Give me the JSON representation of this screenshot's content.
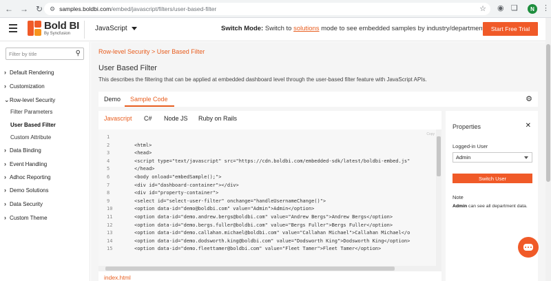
{
  "browser": {
    "url_host": "samples.boldbi.com",
    "url_path": "/embed/javascript/filters/user-based-filter",
    "profile_initial": "N"
  },
  "header": {
    "logo_text": "Bold BI",
    "logo_sub": "By Syncfusion",
    "language": "JavaScript",
    "switch_mode_label": "Switch Mode:",
    "switch_mode_pre": "Switch to",
    "switch_mode_link": "solutions",
    "switch_mode_post": "mode to see embedded samples by industry/department.",
    "trial_button": "Start Free Trial"
  },
  "sidebar": {
    "filter_placeholder": "Filter by title",
    "items": [
      {
        "label": "Default Rendering"
      },
      {
        "label": "Customization"
      },
      {
        "label": "Row-level Security"
      },
      {
        "label": "Filter Parameters"
      },
      {
        "label": "User Based Filter"
      },
      {
        "label": "Custom Attribute"
      },
      {
        "label": "Data Binding"
      },
      {
        "label": "Event Handling"
      },
      {
        "label": "Adhoc Reporting"
      },
      {
        "label": "Demo Solutions"
      },
      {
        "label": "Data Security"
      },
      {
        "label": "Custom Theme"
      }
    ]
  },
  "main": {
    "breadcrumb": "Row-level Security  >  User Based Filter",
    "title": "User Based Filter",
    "description": "This describes the filtering that can be applied at embedded dashboard level through the user-based filter feature with JavaScript APIs.",
    "tabs": [
      {
        "label": "Demo"
      },
      {
        "label": "Sample Code"
      }
    ],
    "code_tabs": [
      {
        "label": "Javascript"
      },
      {
        "label": "C#"
      },
      {
        "label": "Node JS"
      },
      {
        "label": "Ruby on Rails"
      }
    ],
    "copy_hint": "Copy",
    "file_label": "index.html",
    "code_lines": [
      {
        "n": "1",
        "text": ""
      },
      {
        "n": "2",
        "text": "<html>"
      },
      {
        "n": "3",
        "text": "<head>"
      },
      {
        "n": "4",
        "text": "<script type=\"text/javascript\" src=\"https://cdn.boldbi.com/embedded-sdk/latest/boldbi-embed.js\""
      },
      {
        "n": "5",
        "text": "</head>"
      },
      {
        "n": "6",
        "text": "<body onload=\"embedSample();\">"
      },
      {
        "n": "7",
        "text": "<div id=\"dashboard-container\"></div>"
      },
      {
        "n": "8",
        "text": "<div id=\"property-container\">"
      },
      {
        "n": "9",
        "text": "<select id=\"select-user-filter\" onchange=\"handleUsernameChange()\">"
      },
      {
        "n": "10",
        "text": "<option data-id=\"demo@boldbi.com\" value=\"Admin\">Admin</option>"
      },
      {
        "n": "11",
        "text": "<option data-id=\"demo.andrew.bergs@boldbi.com\" value=\"Andrew Bergs\">Andrew Bergs</option>"
      },
      {
        "n": "12",
        "text": "<option data-id=\"demo.bergs.fuller@boldbi.com\" value=\"Bergs Fuller\">Bergs Fuller</option>"
      },
      {
        "n": "13",
        "text": "<option data-id=\"demo.callahan.michael@boldbi.com\" value=\"Callahan Michael\">Callahan Michael</o"
      },
      {
        "n": "14",
        "text": "<option data-id=\"demo.dodsworth.king@boldbi.com\" value=\"Dodsworth King\">Dodsworth King</option>"
      },
      {
        "n": "15",
        "text": "<option data-id=\"demo.fleettamer@boldbi.com\" value=\"Fleet Tamer\">Fleet Tamer</option>"
      }
    ]
  },
  "properties": {
    "title": "Properties",
    "logged_in_label": "Logged-in User",
    "logged_in_value": "Admin",
    "switch_button": "Switch User",
    "note_label": "Note",
    "note_bold": "Admin",
    "note_text": " can see all department data."
  },
  "colors": {
    "accent": "#f05a28",
    "link": "#e85d1e"
  }
}
